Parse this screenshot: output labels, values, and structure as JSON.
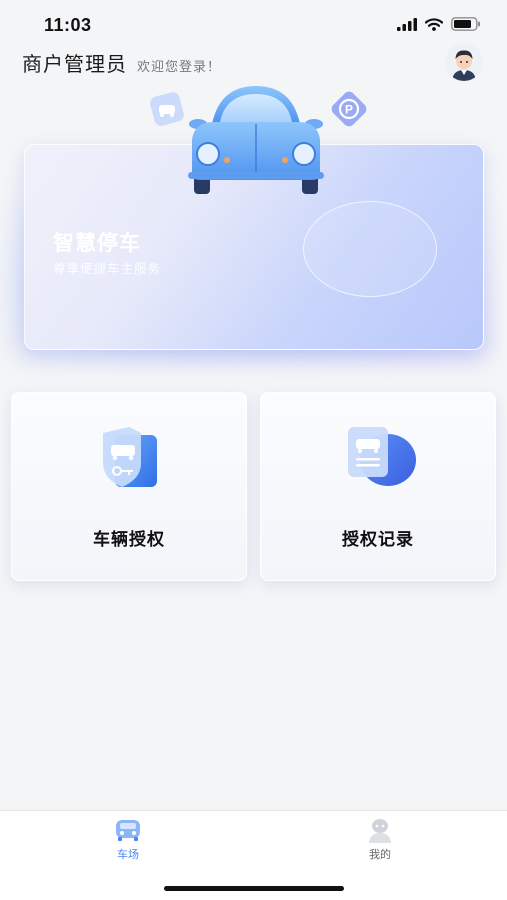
{
  "status_bar": {
    "time": "11:03"
  },
  "header": {
    "title": "商户管理员",
    "subtitle": "欢迎您登录！"
  },
  "banner": {
    "title": "智慧停车",
    "subtitle": "尊享便捷车主服务"
  },
  "cards": [
    {
      "label": "车辆授权",
      "icon": "car-shield-key-icon"
    },
    {
      "label": "授权记录",
      "icon": "car-record-document-icon"
    }
  ],
  "tab_bar": {
    "items": [
      {
        "label": "车场",
        "icon": "car-park-icon",
        "active": true
      },
      {
        "label": "我的",
        "icon": "user-icon",
        "active": false
      }
    ]
  },
  "colors": {
    "accent": "#4a86f0",
    "banner_gradient_end": "#b8c8fb"
  }
}
